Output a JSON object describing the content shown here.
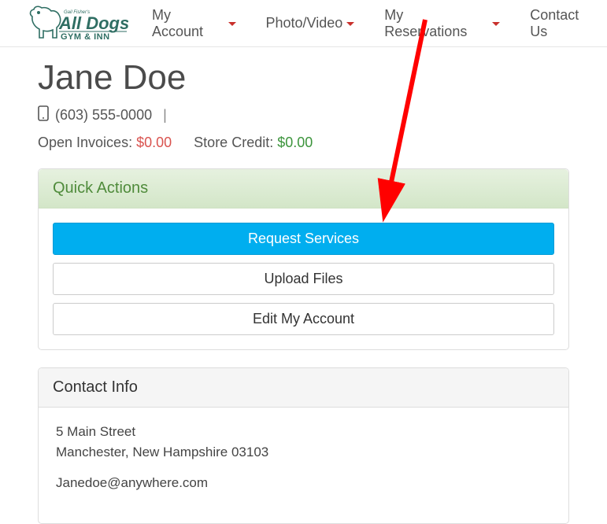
{
  "nav": {
    "items": [
      "My Account",
      "Photo/Video",
      "My Reservations",
      "Contact Us"
    ]
  },
  "page": {
    "title": "Jane Doe",
    "phone": "(603) 555-0000",
    "open_invoices_label": "Open Invoices:",
    "open_invoices_value": "$0.00",
    "store_credit_label": "Store Credit:",
    "store_credit_value": "$0.00"
  },
  "quick_actions": {
    "header": "Quick Actions",
    "buttons": {
      "request": "Request Services",
      "upload": "Upload Files",
      "edit": "Edit My Account"
    }
  },
  "contact": {
    "header": "Contact Info",
    "address_line1": "5 Main Street",
    "address_line2": "Manchester, New Hampshire 03103",
    "email": "Janedoe@anywhere.com"
  },
  "logo": {
    "top": "Gail Fisher's",
    "main": "All Dogs",
    "sub": "GYM & INN"
  }
}
